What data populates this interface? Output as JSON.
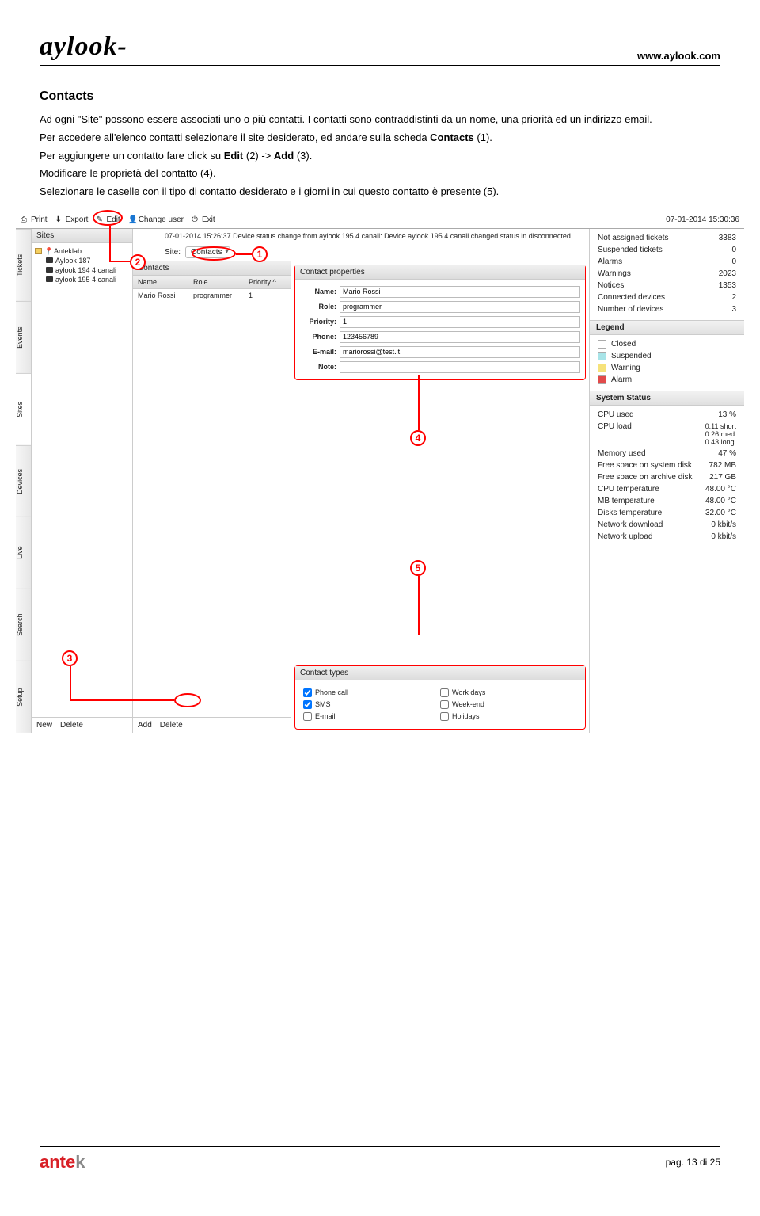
{
  "header": {
    "logo": "aylook-",
    "url": "www.aylook.com"
  },
  "section": {
    "title": "Contacts",
    "p1_a": "Ad ogni \"Site\" possono essere associati uno o più contatti. I contatti sono contraddistinti da un nome, una priorità ed un indirizzo email.",
    "p2_a": "Per accedere all'elenco contatti selezionare il site desiderato, ed andare sulla scheda ",
    "p2_b": "Contacts",
    "p2_c": " (1).",
    "p3_a": "Per aggiungere un contatto fare click su ",
    "p3_b": "Edit",
    "p3_c": " (2) -> ",
    "p3_d": "Add",
    "p3_e": " (3).",
    "p4": "Modificare le proprietà del contatto (4).",
    "p5": "Selezionare le caselle con il tipo di contatto desiderato e i giorni in cui questo contatto è presente (5)."
  },
  "app": {
    "toolbar": {
      "print": "Print",
      "export": "Export",
      "edit": "Edit",
      "changeuser": "Change user",
      "exit": "Exit",
      "datetime": "07-01-2014 15:30:36"
    },
    "vtabs": [
      "Tickets",
      "Events",
      "Sites",
      "Devices",
      "Live",
      "Search",
      "Setup"
    ],
    "sites": {
      "title": "Sites",
      "tree": {
        "root": "Anteklab",
        "items": [
          "Aylook 187",
          "aylook 194 4 canali",
          "aylook 195 4 canali"
        ]
      },
      "new": "New",
      "delete": "Delete"
    },
    "main": {
      "status": "07-01-2014 15:26:37 Device status change from aylook 195 4 canali: Device aylook 195 4 canali changed status in disconnected",
      "tab_label": "Site:",
      "tab_value": "Contacts",
      "contacts": {
        "title": "Contacts",
        "cols": {
          "name": "Name",
          "role": "Role",
          "priority": "Priority ^"
        },
        "rows": [
          {
            "name": "Mario Rossi",
            "role": "programmer",
            "priority": "1"
          }
        ],
        "add": "Add",
        "delete": "Delete"
      },
      "props": {
        "title": "Contact properties",
        "labels": {
          "name": "Name:",
          "role": "Role:",
          "priority": "Priority:",
          "phone": "Phone:",
          "email": "E-mail:",
          "note": "Note:"
        },
        "values": {
          "name": "Mario Rossi",
          "role": "programmer",
          "priority": "1",
          "phone": "123456789",
          "email": "mariorossi@test.it",
          "note": ""
        }
      },
      "types": {
        "title": "Contact types",
        "phone": "Phone call",
        "sms": "SMS",
        "email": "E-mail",
        "work": "Work days",
        "weekend": "Week-end",
        "holidays": "Holidays"
      }
    },
    "right": {
      "stats": {
        "na_tickets": "Not assigned tickets",
        "na_tickets_v": "3383",
        "suspended": "Suspended tickets",
        "suspended_v": "0",
        "alarms": "Alarms",
        "alarms_v": "0",
        "warnings": "Warnings",
        "warnings_v": "2023",
        "notices": "Notices",
        "notices_v": "1353",
        "connected": "Connected devices",
        "connected_v": "2",
        "numdev": "Number of devices",
        "numdev_v": "3"
      },
      "legend_title": "Legend",
      "legend": [
        {
          "label": "Closed",
          "color": "#ffffff"
        },
        {
          "label": "Suspended",
          "color": "#a8e4e8"
        },
        {
          "label": "Warning",
          "color": "#f6e27a"
        },
        {
          "label": "Alarm",
          "color": "#e24a4a"
        }
      ],
      "sys_title": "System Status",
      "sys": {
        "cpu_used": "CPU used",
        "cpu_used_v": "13 %",
        "cpu_load": "CPU load",
        "cpu_load_v": "0.11 short\n0.26 med\n0.43 long",
        "mem": "Memory used",
        "mem_v": "47 %",
        "free_sys": "Free space on system disk",
        "free_sys_v": "782 MB",
        "free_arc": "Free space on archive disk",
        "free_arc_v": "217 GB",
        "cpu_temp": "CPU temperature",
        "cpu_temp_v": "48.00 °C",
        "mb_temp": "MB temperature",
        "mb_temp_v": "48.00 °C",
        "disk_temp": "Disks temperature",
        "disk_temp_v": "32.00 °C",
        "net_down": "Network download",
        "net_down_v": "0 kbit/s",
        "net_up": "Network upload",
        "net_up_v": "0 kbit/s"
      }
    }
  },
  "annotations": [
    "1",
    "2",
    "3",
    "4",
    "5"
  ],
  "footer": {
    "brand_a": "ante",
    "brand_b": "k",
    "page": "pag. 13 di 25"
  }
}
